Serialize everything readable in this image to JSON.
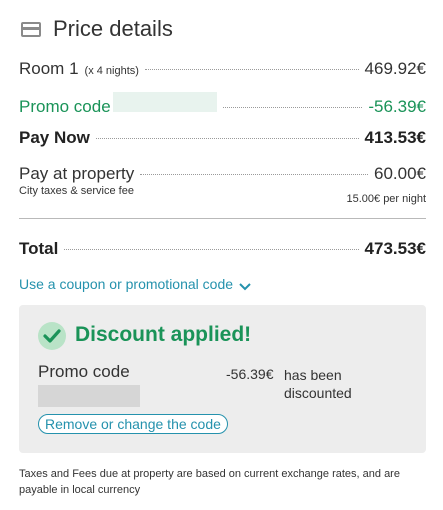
{
  "header": {
    "title": "Price details",
    "icon": "credit-card-icon"
  },
  "rows": {
    "room": {
      "label": "Room 1",
      "note": "(x 4 nights)",
      "value": "469.92€"
    },
    "promo": {
      "label": "Promo code",
      "value": "-56.39€"
    },
    "pay_now": {
      "label": "Pay Now",
      "value": "413.53€"
    },
    "pay_property": {
      "label": "Pay at property",
      "value": "60.00€",
      "sub_left": "City taxes & service fee",
      "sub_right_amount": "15.00€",
      "sub_right_unit": "per night"
    },
    "total": {
      "label": "Total",
      "value": "473.53€"
    }
  },
  "coupon": {
    "link_label": "Use a coupon or promotional code"
  },
  "discount_panel": {
    "title": "Discount applied!",
    "promo_label": "Promo code",
    "amount": "-56.39€",
    "message": "has been discounted",
    "change_label": "Remove or change the code"
  },
  "footer": {
    "note": "Taxes and Fees due at property are based on current exchange rates, and are payable in local currency"
  },
  "colors": {
    "accent_green": "#1a9358",
    "link_blue": "#2592ad",
    "panel_bg": "#ededed"
  }
}
